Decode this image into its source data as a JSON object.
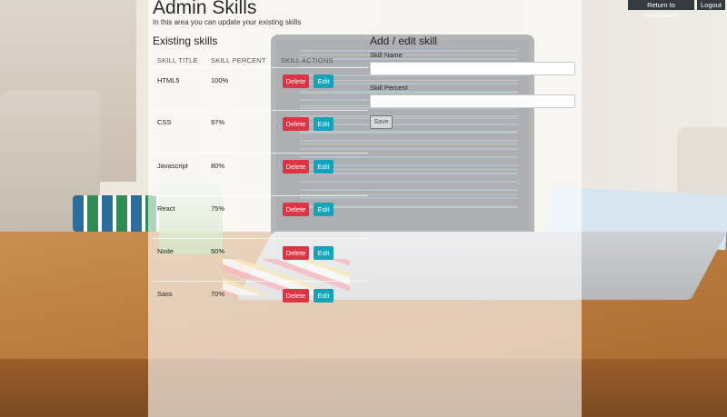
{
  "header": {
    "title": "Admin Skills",
    "subtitle": "In this area you can update your existing skills",
    "return_label": "Return to Dashboard",
    "logout_label": "Logout"
  },
  "existing": {
    "heading": "Existing skills",
    "columns": [
      "SKILL TITLE",
      "SKILL PERCENT",
      "SKILL ACTIONS"
    ],
    "delete_label": "Delete",
    "edit_label": "Edit",
    "rows": [
      {
        "title": "HTML5",
        "percent": "100%"
      },
      {
        "title": "CSS",
        "percent": "97%"
      },
      {
        "title": "Javascript",
        "percent": "80%"
      },
      {
        "title": "React",
        "percent": "75%"
      },
      {
        "title": "Node",
        "percent": "50%"
      },
      {
        "title": "Sass",
        "percent": "70%"
      }
    ]
  },
  "form": {
    "heading": "Add / edit skill",
    "name_label": "Skill Name",
    "name_value": "",
    "percent_label": "Skill Percent",
    "percent_value": "",
    "save_label": "Save"
  },
  "colors": {
    "delete": "#dc3545",
    "edit": "#17a2b8",
    "topbar": "#343a40"
  }
}
